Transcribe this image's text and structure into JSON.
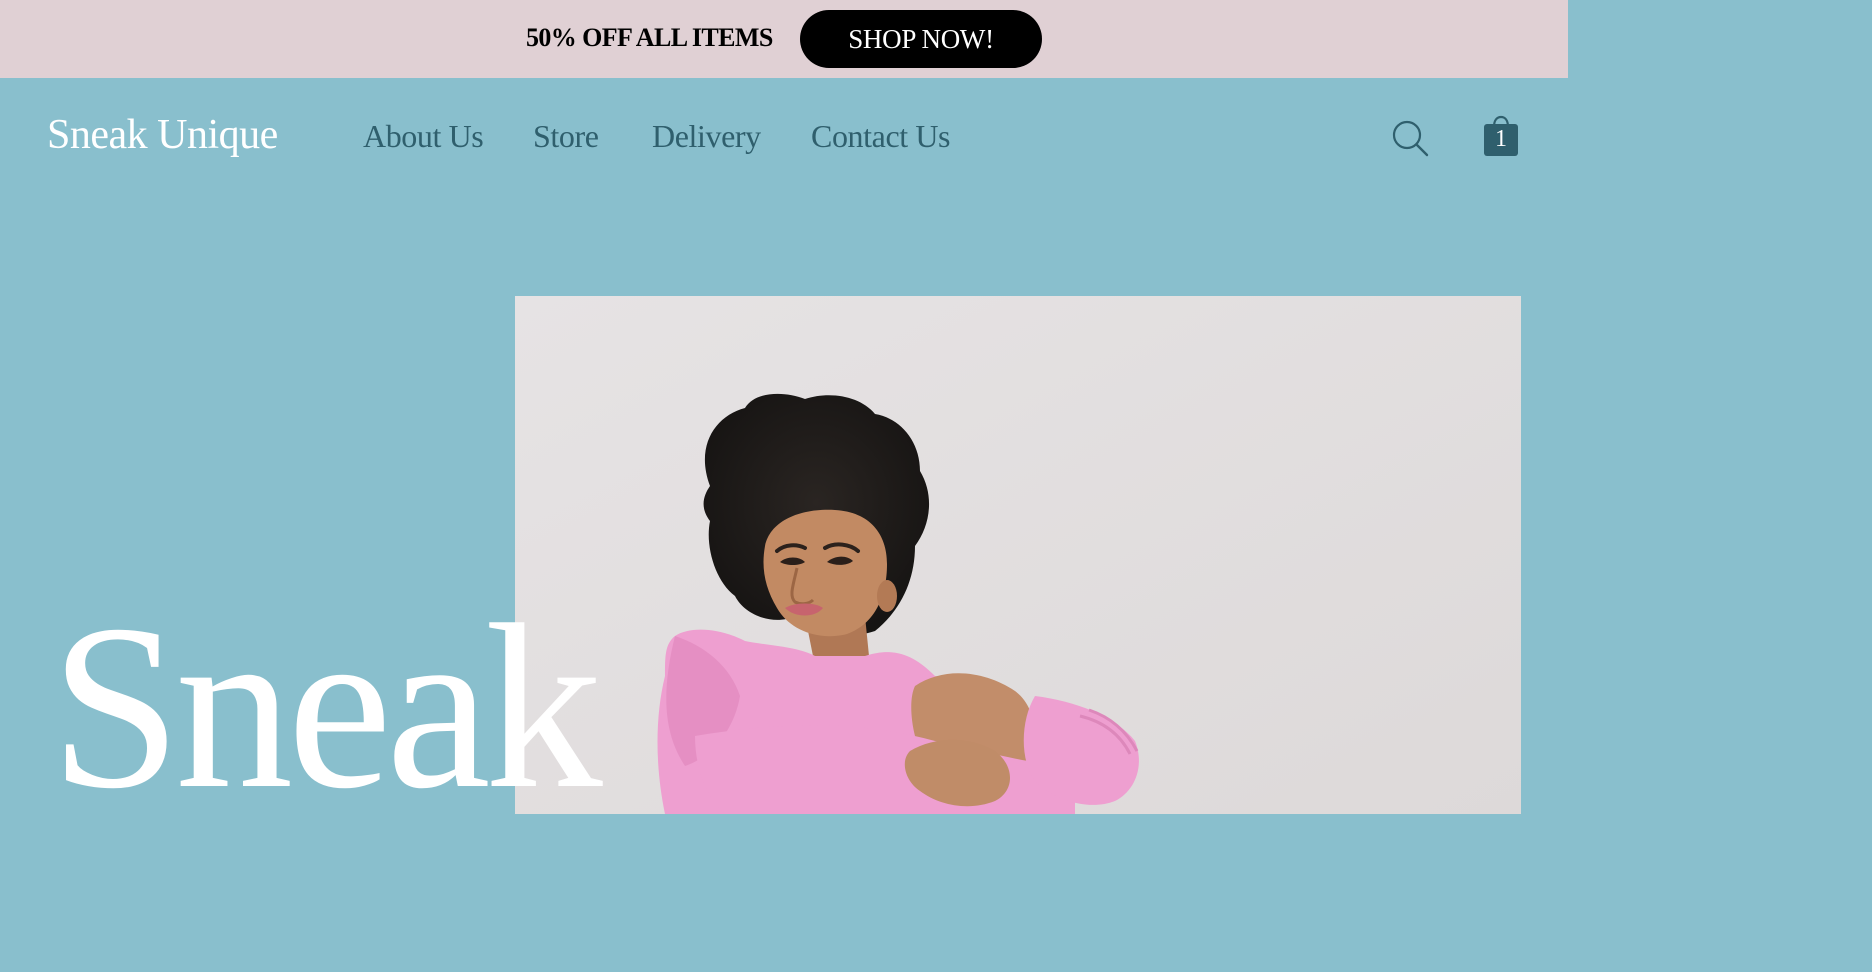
{
  "promo": {
    "text": "50% OFF ALL ITEMS",
    "button_label": "SHOP NOW!"
  },
  "header": {
    "logo": "Sneak Unique",
    "nav": [
      {
        "label": "About Us"
      },
      {
        "label": "Store"
      },
      {
        "label": "Delivery"
      },
      {
        "label": "Contact Us"
      }
    ],
    "cart_count": "1",
    "icons": [
      "search-icon",
      "shopping-bag-icon"
    ]
  },
  "hero": {
    "title": "Sneak",
    "image": "photo of a person with curly hair wearing a pink hoodie, hugging their knees"
  },
  "colors": {
    "promo_bg": "#e0d0d4",
    "page_bg": "#89bfcd",
    "nav_text": "#2f5f6d",
    "logo_text": "#ffffff",
    "hoodie_pink": "#ee9fd0",
    "button_bg": "#000000"
  }
}
